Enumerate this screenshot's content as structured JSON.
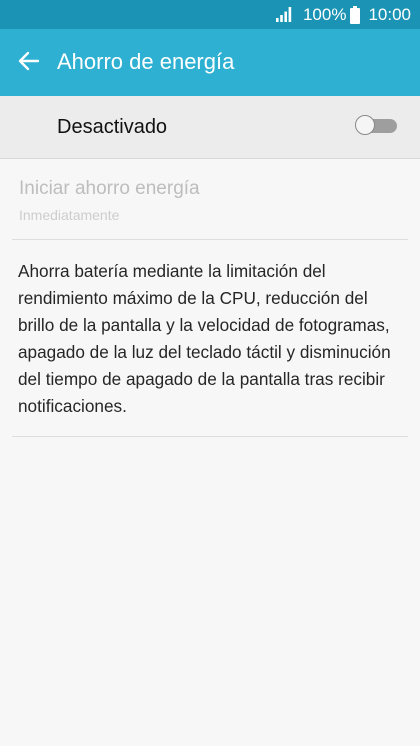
{
  "status_bar": {
    "battery_percent": "100%",
    "time": "10:00",
    "icons": [
      "signal-icon",
      "battery-icon"
    ]
  },
  "app_bar": {
    "back_icon": "back-arrow-icon",
    "title": "Ahorro de energía"
  },
  "master_switch": {
    "label": "Desactivado",
    "state": "off"
  },
  "start_setting": {
    "title": "Iniciar ahorro energía",
    "value": "Inmediatamente",
    "enabled": false
  },
  "description": "Ahorra batería mediante la limitación del rendimiento máximo de la CPU, reducción del brillo de la pantalla y la velocidad de fotogramas, apagado de la luz del teclado táctil y disminución del tiempo de apagado de la pantalla tras recibir notificaciones.",
  "colors": {
    "status_bar": "#1a93b4",
    "app_bar": "#2db0d1",
    "background": "#f7f7f7"
  }
}
